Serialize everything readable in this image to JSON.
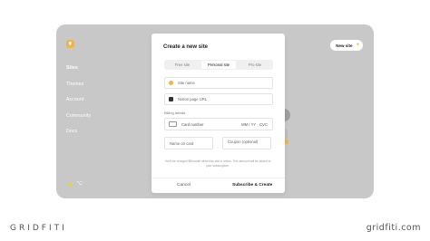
{
  "sidebar": {
    "items": [
      {
        "label": "Sites",
        "active": true
      },
      {
        "label": "Themes"
      },
      {
        "label": "Account"
      },
      {
        "label": "Community"
      },
      {
        "label": "Docs"
      }
    ]
  },
  "header": {
    "new_site_label": "New site"
  },
  "modal": {
    "title": "Create a new site",
    "tabs": [
      {
        "label": "Free site"
      },
      {
        "label": "Personal site",
        "active": true
      },
      {
        "label": "Pro site"
      }
    ],
    "site_name_placeholder": "Site name",
    "notion_url_placeholder": "Notion page URL",
    "billing_label": "Billing details",
    "card_number_placeholder": "Card number",
    "card_exp_placeholder": "MM / YY",
    "card_cvc_placeholder": "CVC",
    "name_on_card_placeholder": "Name on card",
    "coupon_placeholder": "Coupon (optional)",
    "note": "You'll be charged $8/month while this site is online. This amount will be added to your subscription.",
    "cancel_label": "Cancel",
    "submit_label": "Subscribe & Create"
  },
  "brand": {
    "left": "GRIDFITI",
    "right": "gridfiti.com"
  },
  "colors": {
    "accent": "#f3b441",
    "app_bg": "#c8c8c8"
  }
}
